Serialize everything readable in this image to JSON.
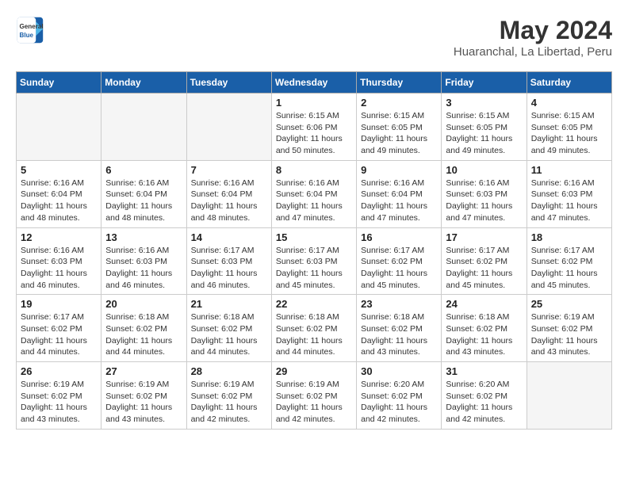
{
  "header": {
    "logo_general": "General",
    "logo_blue": "Blue",
    "month_year": "May 2024",
    "location": "Huaranchal, La Libertad, Peru"
  },
  "weekdays": [
    "Sunday",
    "Monday",
    "Tuesday",
    "Wednesday",
    "Thursday",
    "Friday",
    "Saturday"
  ],
  "weeks": [
    [
      {
        "day": "",
        "info": ""
      },
      {
        "day": "",
        "info": ""
      },
      {
        "day": "",
        "info": ""
      },
      {
        "day": "1",
        "info": "Sunrise: 6:15 AM\nSunset: 6:06 PM\nDaylight: 11 hours\nand 50 minutes."
      },
      {
        "day": "2",
        "info": "Sunrise: 6:15 AM\nSunset: 6:05 PM\nDaylight: 11 hours\nand 49 minutes."
      },
      {
        "day": "3",
        "info": "Sunrise: 6:15 AM\nSunset: 6:05 PM\nDaylight: 11 hours\nand 49 minutes."
      },
      {
        "day": "4",
        "info": "Sunrise: 6:15 AM\nSunset: 6:05 PM\nDaylight: 11 hours\nand 49 minutes."
      }
    ],
    [
      {
        "day": "5",
        "info": "Sunrise: 6:16 AM\nSunset: 6:04 PM\nDaylight: 11 hours\nand 48 minutes."
      },
      {
        "day": "6",
        "info": "Sunrise: 6:16 AM\nSunset: 6:04 PM\nDaylight: 11 hours\nand 48 minutes."
      },
      {
        "day": "7",
        "info": "Sunrise: 6:16 AM\nSunset: 6:04 PM\nDaylight: 11 hours\nand 48 minutes."
      },
      {
        "day": "8",
        "info": "Sunrise: 6:16 AM\nSunset: 6:04 PM\nDaylight: 11 hours\nand 47 minutes."
      },
      {
        "day": "9",
        "info": "Sunrise: 6:16 AM\nSunset: 6:04 PM\nDaylight: 11 hours\nand 47 minutes."
      },
      {
        "day": "10",
        "info": "Sunrise: 6:16 AM\nSunset: 6:03 PM\nDaylight: 11 hours\nand 47 minutes."
      },
      {
        "day": "11",
        "info": "Sunrise: 6:16 AM\nSunset: 6:03 PM\nDaylight: 11 hours\nand 47 minutes."
      }
    ],
    [
      {
        "day": "12",
        "info": "Sunrise: 6:16 AM\nSunset: 6:03 PM\nDaylight: 11 hours\nand 46 minutes."
      },
      {
        "day": "13",
        "info": "Sunrise: 6:16 AM\nSunset: 6:03 PM\nDaylight: 11 hours\nand 46 minutes."
      },
      {
        "day": "14",
        "info": "Sunrise: 6:17 AM\nSunset: 6:03 PM\nDaylight: 11 hours\nand 46 minutes."
      },
      {
        "day": "15",
        "info": "Sunrise: 6:17 AM\nSunset: 6:03 PM\nDaylight: 11 hours\nand 45 minutes."
      },
      {
        "day": "16",
        "info": "Sunrise: 6:17 AM\nSunset: 6:02 PM\nDaylight: 11 hours\nand 45 minutes."
      },
      {
        "day": "17",
        "info": "Sunrise: 6:17 AM\nSunset: 6:02 PM\nDaylight: 11 hours\nand 45 minutes."
      },
      {
        "day": "18",
        "info": "Sunrise: 6:17 AM\nSunset: 6:02 PM\nDaylight: 11 hours\nand 45 minutes."
      }
    ],
    [
      {
        "day": "19",
        "info": "Sunrise: 6:17 AM\nSunset: 6:02 PM\nDaylight: 11 hours\nand 44 minutes."
      },
      {
        "day": "20",
        "info": "Sunrise: 6:18 AM\nSunset: 6:02 PM\nDaylight: 11 hours\nand 44 minutes."
      },
      {
        "day": "21",
        "info": "Sunrise: 6:18 AM\nSunset: 6:02 PM\nDaylight: 11 hours\nand 44 minutes."
      },
      {
        "day": "22",
        "info": "Sunrise: 6:18 AM\nSunset: 6:02 PM\nDaylight: 11 hours\nand 44 minutes."
      },
      {
        "day": "23",
        "info": "Sunrise: 6:18 AM\nSunset: 6:02 PM\nDaylight: 11 hours\nand 43 minutes."
      },
      {
        "day": "24",
        "info": "Sunrise: 6:18 AM\nSunset: 6:02 PM\nDaylight: 11 hours\nand 43 minutes."
      },
      {
        "day": "25",
        "info": "Sunrise: 6:19 AM\nSunset: 6:02 PM\nDaylight: 11 hours\nand 43 minutes."
      }
    ],
    [
      {
        "day": "26",
        "info": "Sunrise: 6:19 AM\nSunset: 6:02 PM\nDaylight: 11 hours\nand 43 minutes."
      },
      {
        "day": "27",
        "info": "Sunrise: 6:19 AM\nSunset: 6:02 PM\nDaylight: 11 hours\nand 43 minutes."
      },
      {
        "day": "28",
        "info": "Sunrise: 6:19 AM\nSunset: 6:02 PM\nDaylight: 11 hours\nand 42 minutes."
      },
      {
        "day": "29",
        "info": "Sunrise: 6:19 AM\nSunset: 6:02 PM\nDaylight: 11 hours\nand 42 minutes."
      },
      {
        "day": "30",
        "info": "Sunrise: 6:20 AM\nSunset: 6:02 PM\nDaylight: 11 hours\nand 42 minutes."
      },
      {
        "day": "31",
        "info": "Sunrise: 6:20 AM\nSunset: 6:02 PM\nDaylight: 11 hours\nand 42 minutes."
      },
      {
        "day": "",
        "info": ""
      }
    ]
  ]
}
